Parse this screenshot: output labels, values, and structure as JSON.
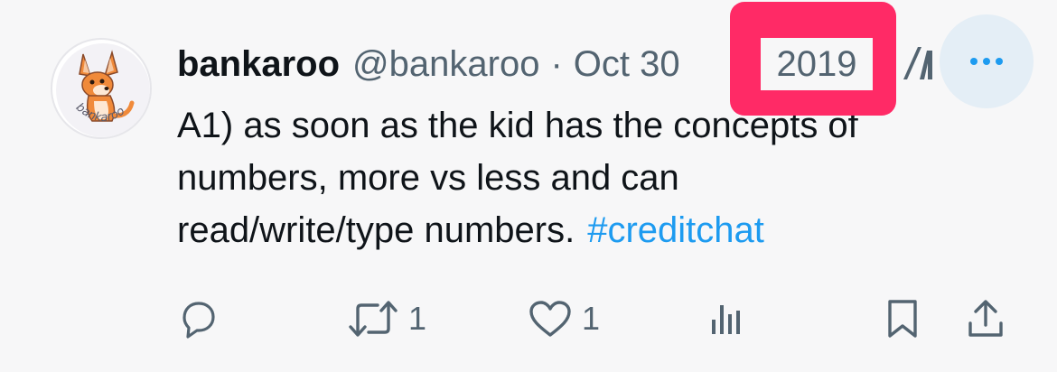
{
  "tweet": {
    "author_name": "bankaroo",
    "handle": "@bankaroo",
    "separator": "·",
    "date_month_day": "Oct 30",
    "date_year": "2019",
    "text_lines": [
      "A1) as soon as the kid has the concepts of",
      "numbers, more vs less and can",
      "read/write/type numbers."
    ],
    "hashtag": "#creditchat",
    "avatar_text": "bankaroo"
  },
  "actions": {
    "reply_count": "",
    "retweet_count": "1",
    "like_count": "1",
    "views_count": ""
  },
  "icons": {
    "avatar": "kangaroo-logo-icon",
    "grok": "grok-icon",
    "more": "more-dots-icon",
    "reply": "reply-icon",
    "retweet": "retweet-icon",
    "like": "heart-icon",
    "views": "views-bar-icon",
    "bookmark": "bookmark-icon",
    "share": "share-icon"
  },
  "colors": {
    "background": "#f7f7f8",
    "text": "#0f1419",
    "secondary_text": "#536471",
    "link": "#1d9bf0",
    "highlight": "#ff2a66",
    "more_button_bg": "#e4eef6"
  }
}
